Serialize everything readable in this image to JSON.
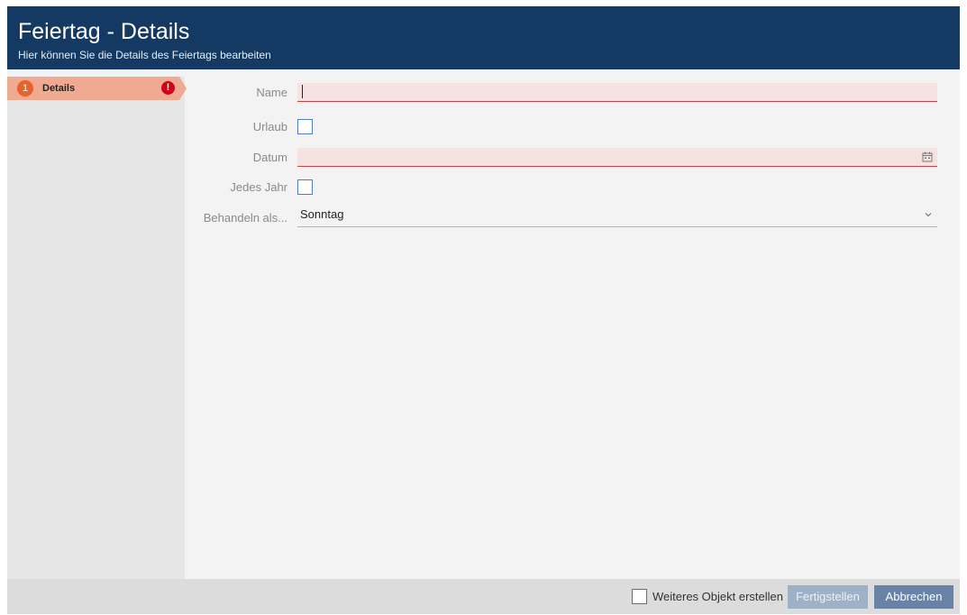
{
  "header": {
    "title": "Feiertag - Details",
    "subtitle": "Hier können Sie die Details des Feiertags bearbeiten"
  },
  "sidebar": {
    "steps": [
      {
        "number": "1",
        "label": "Details",
        "error_icon": "exclamation-icon",
        "error_glyph": "!"
      }
    ]
  },
  "form": {
    "name": {
      "label": "Name",
      "value": ""
    },
    "vacation": {
      "label": "Urlaub",
      "checked": false
    },
    "date": {
      "label": "Datum",
      "value": "",
      "icon": "calendar-icon"
    },
    "every_year": {
      "label": "Jedes Jahr",
      "checked": false
    },
    "treat_as": {
      "label": "Behandeln als...",
      "value": "Sonntag",
      "icon": "chevron-down-icon"
    }
  },
  "footer": {
    "create_another_label": "Weiteres Objekt erstellen",
    "create_another_checked": false,
    "finish_label": "Fertigstellen",
    "cancel_label": "Abbrechen"
  },
  "colors": {
    "header": "#143a64",
    "step_active": "#f0aa92",
    "step_number": "#e8622b",
    "error": "#d4001a",
    "invalid_field": "#f5e3e2",
    "invalid_border": "#c9424a",
    "button_primary": "#6983a6",
    "button_disabled": "#9fb1c6"
  }
}
